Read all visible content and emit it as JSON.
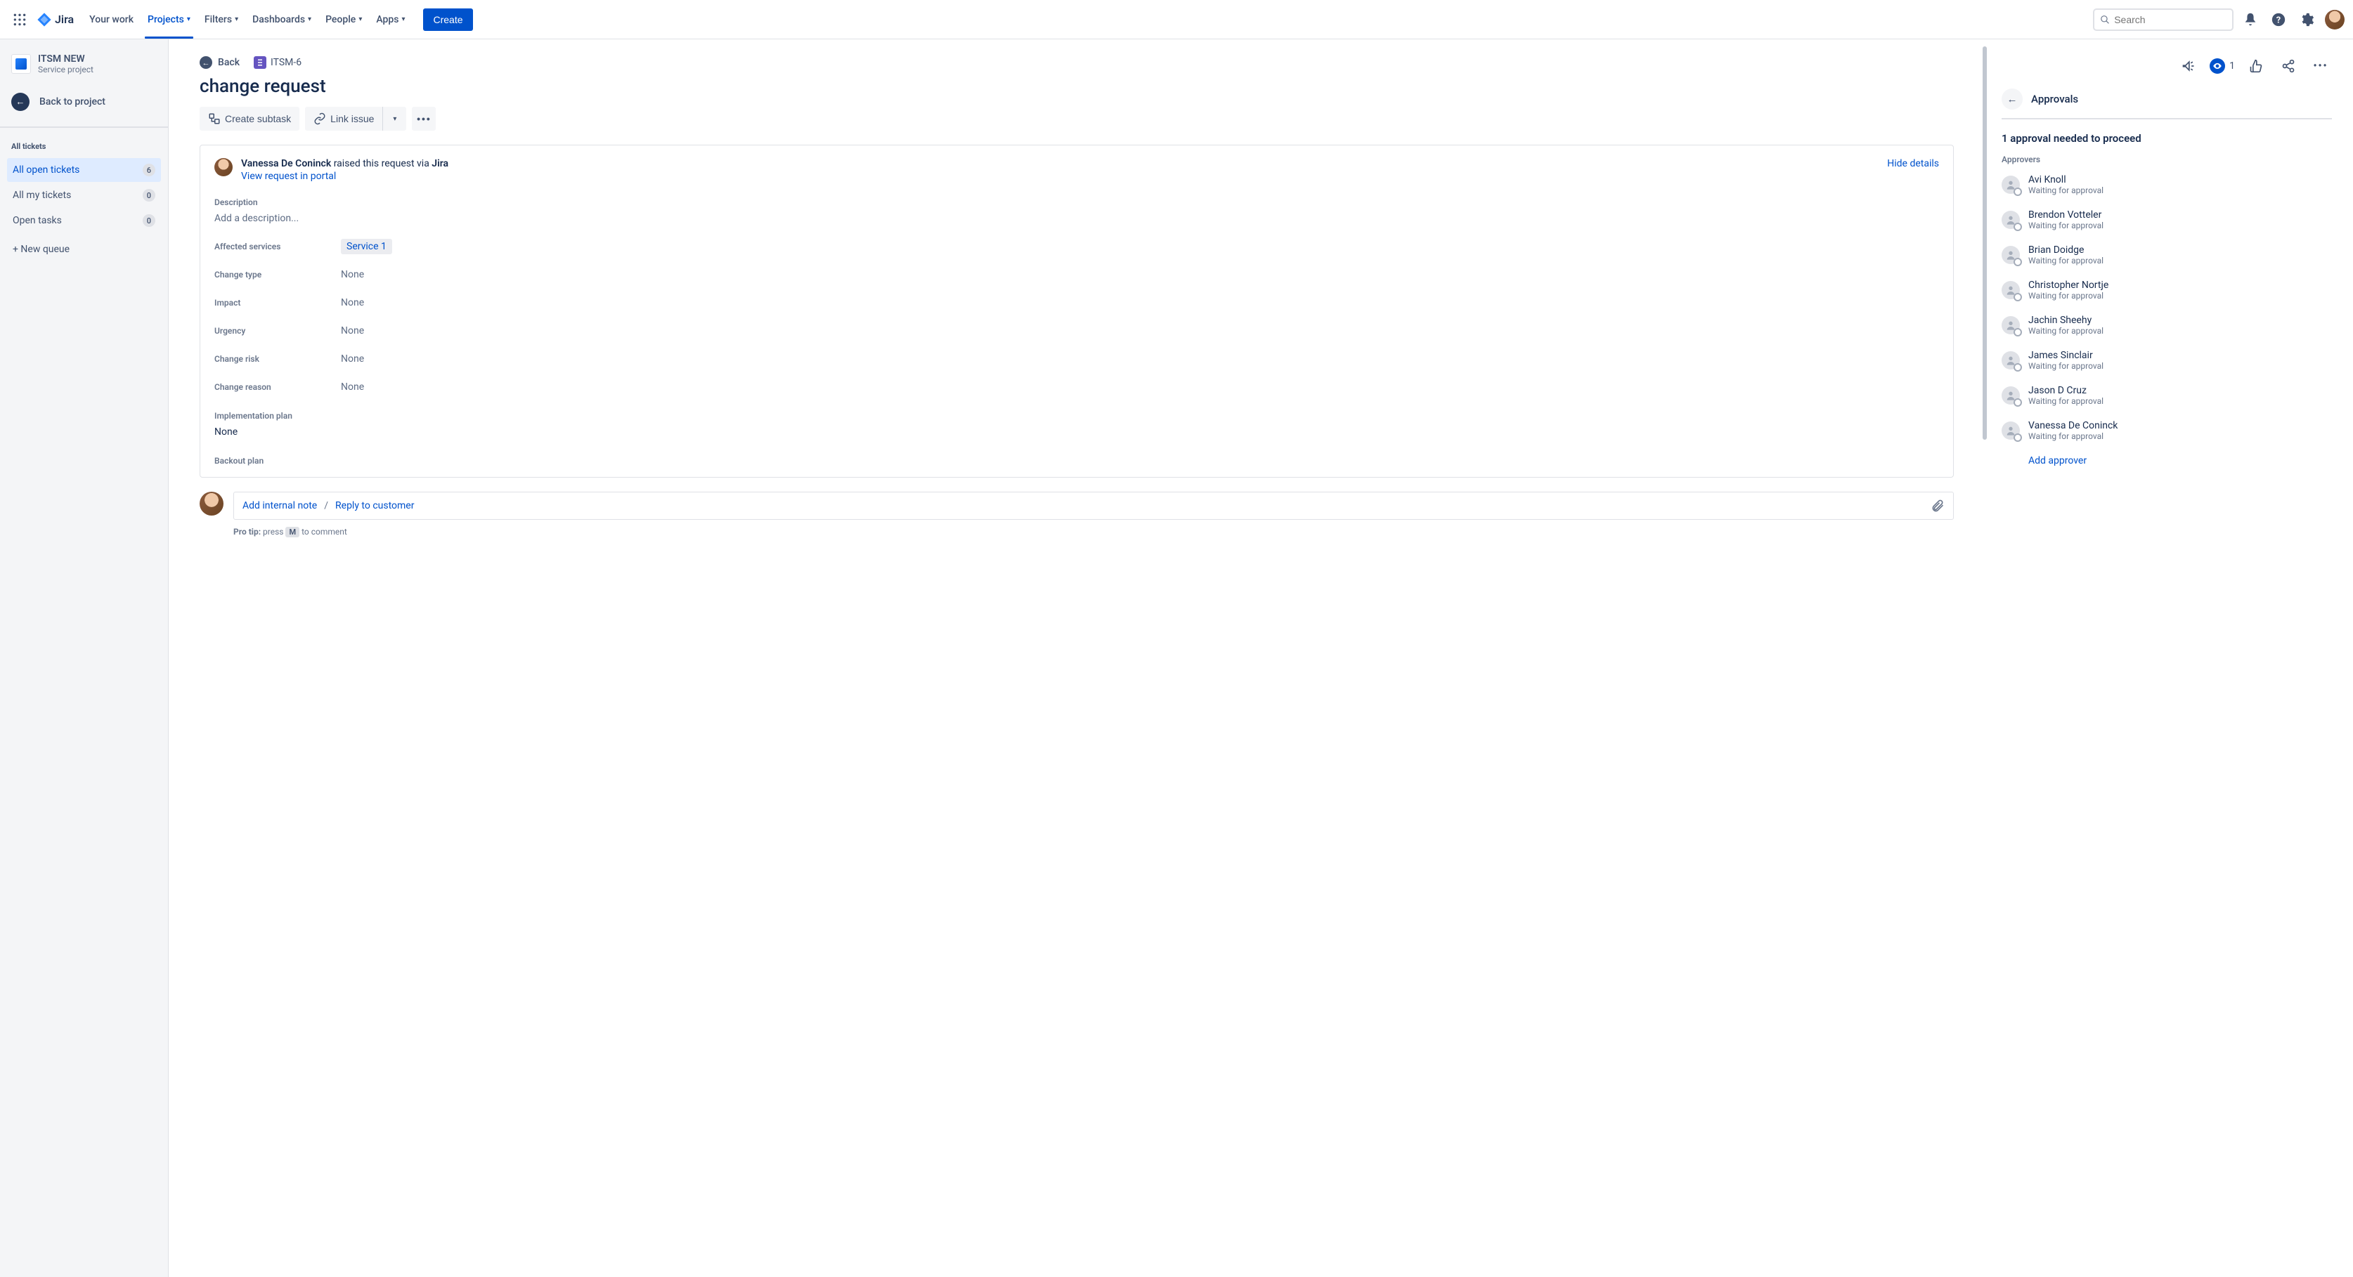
{
  "topnav": {
    "logo_text": "Jira",
    "items": [
      {
        "label": "Your work",
        "dropdown": false,
        "active": false
      },
      {
        "label": "Projects",
        "dropdown": true,
        "active": true
      },
      {
        "label": "Filters",
        "dropdown": true,
        "active": false
      },
      {
        "label": "Dashboards",
        "dropdown": true,
        "active": false
      },
      {
        "label": "People",
        "dropdown": true,
        "active": false
      },
      {
        "label": "Apps",
        "dropdown": true,
        "active": false
      }
    ],
    "create_label": "Create",
    "search_placeholder": "Search"
  },
  "sidebar": {
    "project_name": "ITSM NEW",
    "project_sub": "Service project",
    "back_label": "Back to project",
    "section_title": "All tickets",
    "queues": [
      {
        "label": "All open tickets",
        "count": "6",
        "active": true
      },
      {
        "label": "All my tickets",
        "count": "0",
        "active": false
      },
      {
        "label": "Open tasks",
        "count": "0",
        "active": false
      }
    ],
    "new_queue_label": "+ New queue"
  },
  "issue": {
    "back_label": "Back",
    "key": "ITSM-6",
    "title": "change request",
    "actions": {
      "create_subtask": "Create subtask",
      "link_issue": "Link issue"
    },
    "requester_name": "Vanessa De Coninck",
    "requester_mid": " raised this request via ",
    "requester_via": "Jira",
    "hide_details": "Hide details",
    "view_portal": "View request in portal",
    "description_label": "Description",
    "description_placeholder": "Add a description...",
    "fields": [
      {
        "label": "Affected services",
        "type": "service",
        "value": "Service 1"
      },
      {
        "label": "Change type",
        "type": "none",
        "value": "None"
      },
      {
        "label": "Impact",
        "type": "none",
        "value": "None"
      },
      {
        "label": "Urgency",
        "type": "none",
        "value": "None"
      },
      {
        "label": "Change risk",
        "type": "none",
        "value": "None"
      },
      {
        "label": "Change reason",
        "type": "none",
        "value": "None"
      }
    ],
    "impl_plan_label": "Implementation plan",
    "impl_plan_value": "None",
    "backout_plan_label": "Backout plan"
  },
  "comment": {
    "internal_note": "Add internal note",
    "separator": "/",
    "reply_customer": "Reply to customer",
    "protip_lead": "Pro tip:",
    "protip_before": " press ",
    "protip_key": "M",
    "protip_after": " to comment"
  },
  "right": {
    "watch_count": "1",
    "approvals_title": "Approvals",
    "needed_text": "1 approval needed to proceed",
    "approvers_label": "Approvers",
    "approvers": [
      {
        "name": "Avi Knoll",
        "status": "Waiting for approval"
      },
      {
        "name": "Brendon Votteler",
        "status": "Waiting for approval"
      },
      {
        "name": "Brian Doidge",
        "status": "Waiting for approval"
      },
      {
        "name": "Christopher Nortje",
        "status": "Waiting for approval"
      },
      {
        "name": "Jachin Sheehy",
        "status": "Waiting for approval"
      },
      {
        "name": "James Sinclair",
        "status": "Waiting for approval"
      },
      {
        "name": "Jason D Cruz",
        "status": "Waiting for approval"
      },
      {
        "name": "Vanessa De Coninck",
        "status": "Waiting for approval"
      }
    ],
    "add_approver": "Add approver"
  }
}
